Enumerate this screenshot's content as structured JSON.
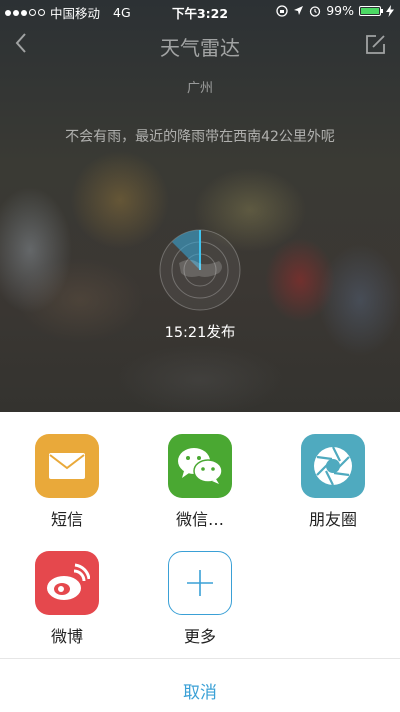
{
  "status_bar": {
    "carrier": "中国移动",
    "network": "4G",
    "time": "下午3:22",
    "battery_percent": "99%",
    "battery_level": 0.99,
    "signal_strength": 3,
    "colors": {
      "battery": "#4cd964"
    }
  },
  "nav": {
    "title": "天气雷达",
    "back_icon": "chevron-left-icon",
    "edit_icon": "edit-icon"
  },
  "radar": {
    "city": "广州",
    "message": "不会有雨，最近的降雨带在西南42公里外呢",
    "publish_time": "15:21发布"
  },
  "share": {
    "items": [
      {
        "label": "短信",
        "icon": "mail-icon",
        "color": "#e9a93a"
      },
      {
        "label": "微信…",
        "icon": "wechat-icon",
        "color": "#4aa832"
      },
      {
        "label": "朋友圈",
        "icon": "aperture-icon",
        "color": "#4faabf"
      },
      {
        "label": "微博",
        "icon": "weibo-icon",
        "color": "#e5484d"
      },
      {
        "label": "更多",
        "icon": "plus-icon",
        "color": "#3aa0d6"
      }
    ],
    "cancel": "取消"
  }
}
